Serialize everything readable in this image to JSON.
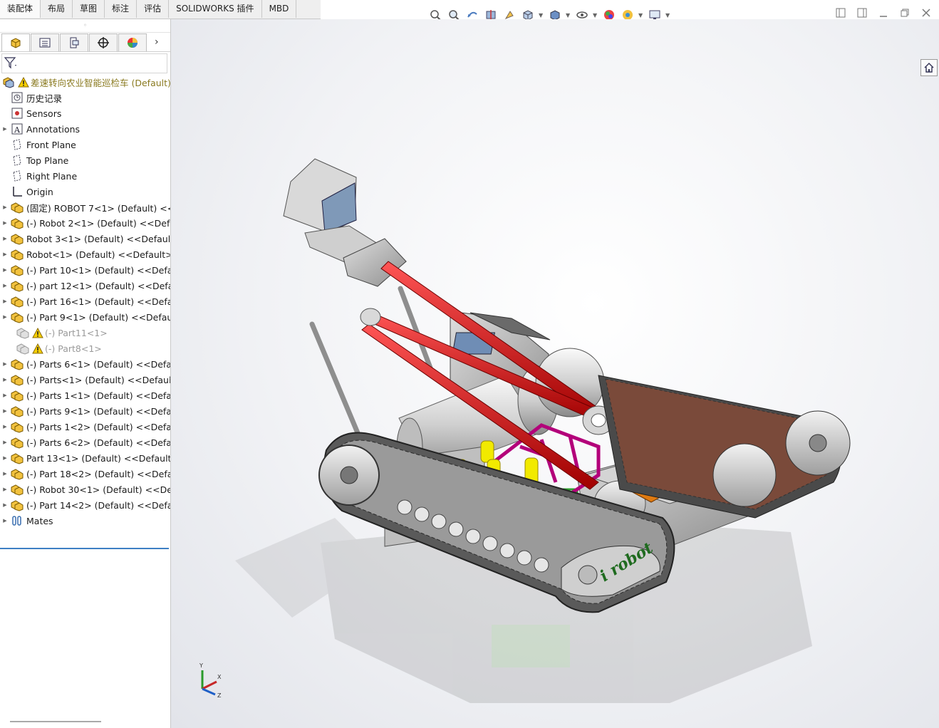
{
  "tabs": [
    "装配体",
    "布局",
    "草图",
    "标注",
    "评估",
    "SOLIDWORKS 插件",
    "MBD"
  ],
  "hud_icons": [
    "zoom-to-fit-icon",
    "zoom-area-icon",
    "previous-view-icon",
    "section-view-icon",
    "dynamic-annotation-icon",
    "view-orientation-icon",
    "display-style-icon",
    "hide-show-icon",
    "edit-appearance-icon",
    "apply-scene-icon",
    "view-settings-icon"
  ],
  "window_controls": [
    "tile-left-icon",
    "tile-right-icon",
    "minimize-icon",
    "restore-icon",
    "close-icon"
  ],
  "panel_tabs": [
    "featuremanager-tab",
    "propertymanager-tab",
    "configurationmanager-tab",
    "dimxpert-tab",
    "display-manager-tab"
  ],
  "tree": {
    "root": "差速转向农业智能巡检车  (Default)",
    "items": [
      {
        "label": "历史记录",
        "icon": "history-icon",
        "expander": false,
        "state": "normal"
      },
      {
        "label": "Sensors",
        "icon": "sensors-icon",
        "expander": false,
        "state": "normal"
      },
      {
        "label": "Annotations",
        "icon": "annotations-icon",
        "expander": true,
        "state": "normal"
      },
      {
        "label": "Front Plane",
        "icon": "plane-icon",
        "expander": false,
        "state": "normal"
      },
      {
        "label": "Top Plane",
        "icon": "plane-icon",
        "expander": false,
        "state": "normal"
      },
      {
        "label": "Right Plane",
        "icon": "plane-icon",
        "expander": false,
        "state": "normal"
      },
      {
        "label": "Origin",
        "icon": "origin-icon",
        "expander": false,
        "state": "normal"
      },
      {
        "label": "(固定) ROBOT 7<1> (Default) <<",
        "icon": "part-icon",
        "expander": true,
        "state": "normal"
      },
      {
        "label": "(-) Robot 2<1> (Default) <<Defa",
        "icon": "part-icon",
        "expander": true,
        "state": "normal"
      },
      {
        "label": "Robot 3<1> (Default) <<Default",
        "icon": "part-icon",
        "expander": true,
        "state": "normal"
      },
      {
        "label": "Robot<1> (Default) <<Default>_",
        "icon": "part-icon",
        "expander": true,
        "state": "normal"
      },
      {
        "label": "(-) Part 10<1> (Default) <<Defau",
        "icon": "part-icon",
        "expander": true,
        "state": "normal"
      },
      {
        "label": "(-) part 12<1> (Default) <<Defau",
        "icon": "part-icon",
        "expander": true,
        "state": "normal"
      },
      {
        "label": "(-) Part 16<1> (Default) <<Defau",
        "icon": "part-icon",
        "expander": true,
        "state": "normal"
      },
      {
        "label": "(-) Part 9<1> (Default) <<Defaul",
        "icon": "part-icon",
        "expander": true,
        "state": "normal"
      },
      {
        "label": "(-) Part11<1>",
        "icon": "part-icon",
        "expander": false,
        "state": "suppressed"
      },
      {
        "label": "(-) Part8<1>",
        "icon": "part-icon",
        "expander": false,
        "state": "suppressed"
      },
      {
        "label": "(-) Parts 6<1> (Default) <<Defau",
        "icon": "part-icon",
        "expander": true,
        "state": "normal"
      },
      {
        "label": "(-) Parts<1> (Default) <<Default:",
        "icon": "part-icon",
        "expander": true,
        "state": "normal"
      },
      {
        "label": "(-) Parts 1<1> (Default) <<Defau",
        "icon": "part-icon",
        "expander": true,
        "state": "normal"
      },
      {
        "label": "(-) Parts 9<1> (Default) <<Defau",
        "icon": "part-icon",
        "expander": true,
        "state": "normal"
      },
      {
        "label": "(-) Parts 1<2> (Default) <<Defau",
        "icon": "part-icon",
        "expander": true,
        "state": "normal"
      },
      {
        "label": "(-) Parts 6<2> (Default) <<Defau",
        "icon": "part-icon",
        "expander": true,
        "state": "normal"
      },
      {
        "label": "Part 13<1> (Default) <<Default>",
        "icon": "part-icon",
        "expander": true,
        "state": "normal"
      },
      {
        "label": "(-) Part 18<2> (Default) <<Defau",
        "icon": "part-icon",
        "expander": true,
        "state": "normal"
      },
      {
        "label": "(-) Robot 30<1> (Default) <<Def",
        "icon": "part-icon",
        "expander": true,
        "state": "normal"
      },
      {
        "label": "(-) Part 14<2> (Default) <<Defau",
        "icon": "part-icon",
        "expander": true,
        "state": "normal"
      },
      {
        "label": "Mates",
        "icon": "mates-icon",
        "expander": true,
        "state": "normal"
      }
    ]
  },
  "model": {
    "track_text": "i robot",
    "colors": {
      "arm": "#d21818",
      "hub": "#c9c9c9",
      "frame": "#b3007a",
      "cylinder": "#f2ea00",
      "box": "#e07a10"
    }
  },
  "triad": {
    "x": "X",
    "y": "Y",
    "z": "Z"
  }
}
